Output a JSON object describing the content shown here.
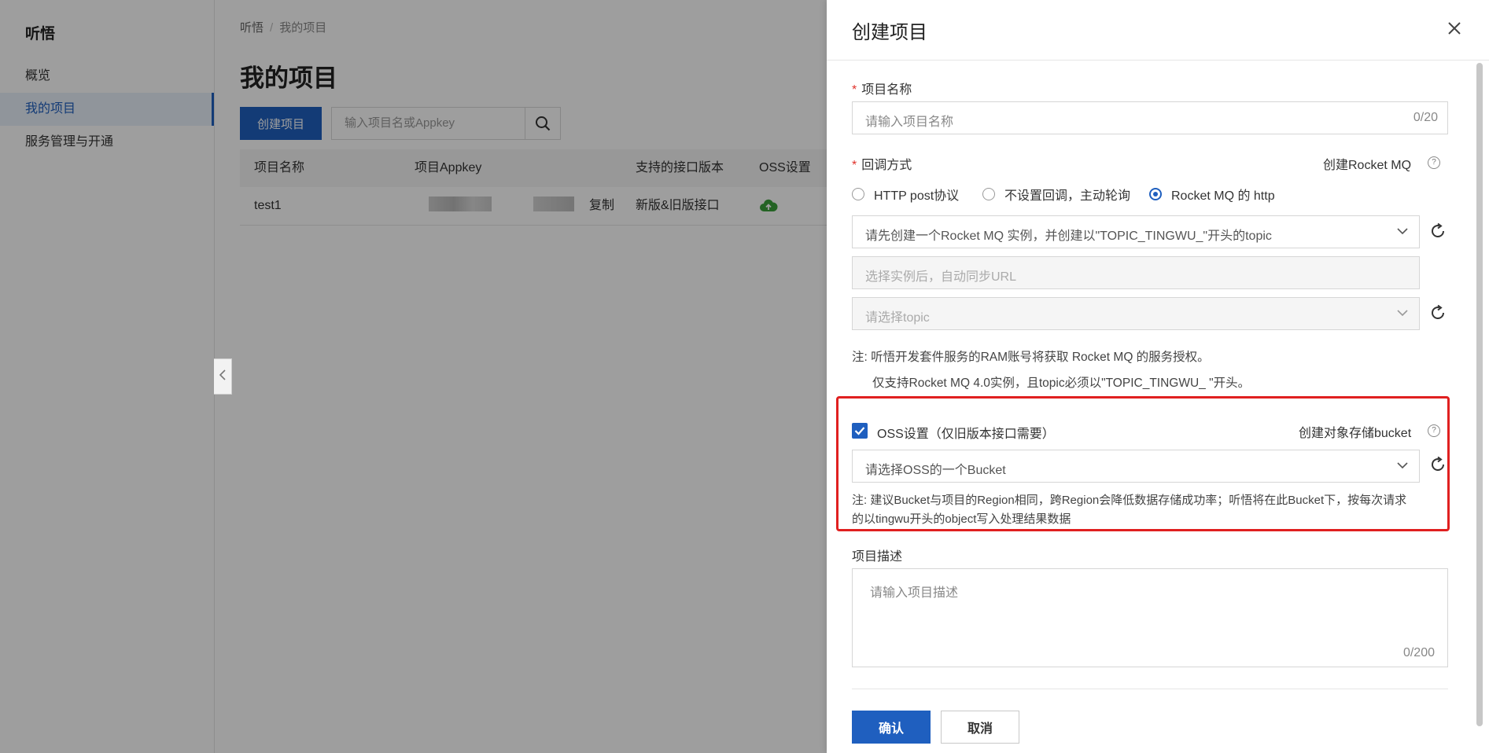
{
  "app": {
    "brand": "听悟",
    "nav": [
      {
        "label": "概览"
      },
      {
        "label": "我的项目"
      },
      {
        "label": "服务管理与开通"
      }
    ]
  },
  "main": {
    "breadcrumb": [
      "听悟",
      "我的项目"
    ],
    "title": "我的项目",
    "create_button": "创建项目",
    "search_placeholder": "输入项目名或Appkey",
    "table": {
      "headers": [
        "项目名称",
        "项目Appkey",
        "支持的接口版本",
        "OSS设置"
      ],
      "rows": [
        {
          "name": "test1",
          "copy": "复制",
          "version": "新版&旧版接口"
        }
      ]
    }
  },
  "drawer": {
    "title": "创建项目",
    "project_name": {
      "label": "项目名称",
      "placeholder": "请输入项目名称",
      "counter": "0/20"
    },
    "callback": {
      "label": "回调方式",
      "create_link": "创建Rocket MQ",
      "options": [
        "HTTP post协议",
        "不设置回调，主动轮询",
        "Rocket MQ 的 http"
      ],
      "selected_option": "Rocket MQ 的 http",
      "instance_placeholder": "请先创建一个Rocket MQ 实例，并创建以\"TOPIC_TINGWU_\"开头的topic",
      "url_placeholder": "选择实例后，自动同步URL",
      "topic_placeholder": "请选择topic",
      "note_line1": "注: 听悟开发套件服务的RAM账号将获取 Rocket MQ 的服务授权。",
      "note_line2": "仅支持Rocket MQ 4.0实例，且topic必须以\"TOPIC_TINGWU_ \"开头。"
    },
    "oss": {
      "checkbox_label": "OSS设置（仅旧版本接口需要）",
      "checked": true,
      "create_link": "创建对象存储bucket",
      "bucket_placeholder": "请选择OSS的一个Bucket",
      "note_line1": "注: 建议Bucket与项目的Region相同，跨Region会降低数据存储成功率；听悟将在此Bucket下，按每次请求",
      "note_line2": "的以tingwu开头的object写入处理结果数据"
    },
    "description": {
      "label": "项目描述",
      "placeholder": "请输入项目描述",
      "counter": "0/200"
    },
    "confirm_button": "确认",
    "cancel_button": "取消"
  },
  "colors": {
    "primary": "#1f5fbf",
    "required": "#e0322b",
    "highlight": "#e02020",
    "oss_status": "#3aa13a"
  },
  "icons": {
    "search": "search-icon",
    "close": "close-icon",
    "chevron": "chevron-down-icon",
    "refresh": "refresh-icon",
    "help": "help-icon",
    "oss_status": "cloud-upload-icon",
    "collapse": "chevron-left-icon",
    "checkbox": "checkbox-checked-icon"
  }
}
